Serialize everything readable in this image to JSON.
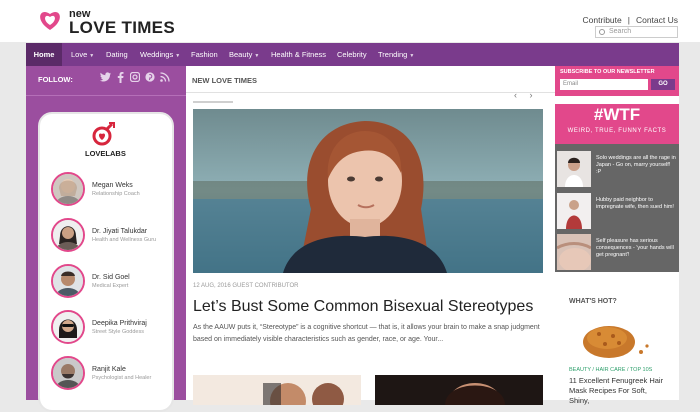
{
  "brand": {
    "new": "new",
    "name": "LOVE TIMES",
    "color": "#e2488b"
  },
  "toplinks": {
    "contribute": "Contribute",
    "separator": "|",
    "contact": "Contact Us"
  },
  "search": {
    "placeholder": "Search"
  },
  "nav": {
    "items": [
      {
        "label": "Home",
        "active": true
      },
      {
        "label": "Love",
        "dropdown": true
      },
      {
        "label": "Dating"
      },
      {
        "label": "Weddings",
        "dropdown": true
      },
      {
        "label": "Fashion"
      },
      {
        "label": "Beauty",
        "dropdown": true
      },
      {
        "label": "Health & Fitness"
      },
      {
        "label": "Celebrity"
      },
      {
        "label": "Trending",
        "dropdown": true
      }
    ],
    "color": "#7a3b8c"
  },
  "sidebar": {
    "follow_label": "FOLLOW:",
    "social": [
      "twitter-icon",
      "facebook-icon",
      "instagram-icon",
      "pinterest-icon",
      "rss-icon"
    ],
    "lovelabs": "LOVELABS",
    "experts": [
      {
        "name": "Megan Weks",
        "role": "Relationship Coach"
      },
      {
        "name": "Dr. Jiyati Talukdar",
        "role": "Health and Wellness Guru"
      },
      {
        "name": "Dr. Sid Goel",
        "role": "Medical Expert"
      },
      {
        "name": "Deepika Prithviraj",
        "role": "Street Style Goddess"
      },
      {
        "name": "Ranjit Kale",
        "role": "Psychologist and Healer"
      }
    ],
    "color": "#9b4e9f"
  },
  "main": {
    "section_title": "NEW LOVE TIMES",
    "meta": "12 AUG, 2016 GUEST CONTRIBUTOR",
    "title": "Let’s Bust Some Common Bisexual Stereotypes",
    "excerpt": "As the AAUW puts it, “Stereotype” is a cognitive shortcut — that is, it allows your brain to make a snap judgment based on immediately visible characteristics such as gender, race, or age. Your..."
  },
  "newsletter": {
    "title": "SUBSCRIBE TO OUR NEWSLETTER",
    "placeholder": "Email",
    "button": "GO"
  },
  "wtf": {
    "title": "#WTF",
    "subtitle": "WEIRD, TRUE, FUNNY FACTS",
    "items": [
      {
        "text": "Solo weddings are all the rage in Japan - Go on, marry yourself! :P"
      },
      {
        "text": "Hubby paid neighbor to impregnate wife, then sued him!"
      },
      {
        "text": "Self pleasure has serious consequences - 'your hands will get pregnant'!"
      }
    ]
  },
  "hot": {
    "title": "WHAT'S HOT?",
    "category": "BEAUTY / HAIR CARE / TOP 10S",
    "text": "11 Excellent Fenugreek Hair Mask Recipes For Soft, Shiny,"
  }
}
